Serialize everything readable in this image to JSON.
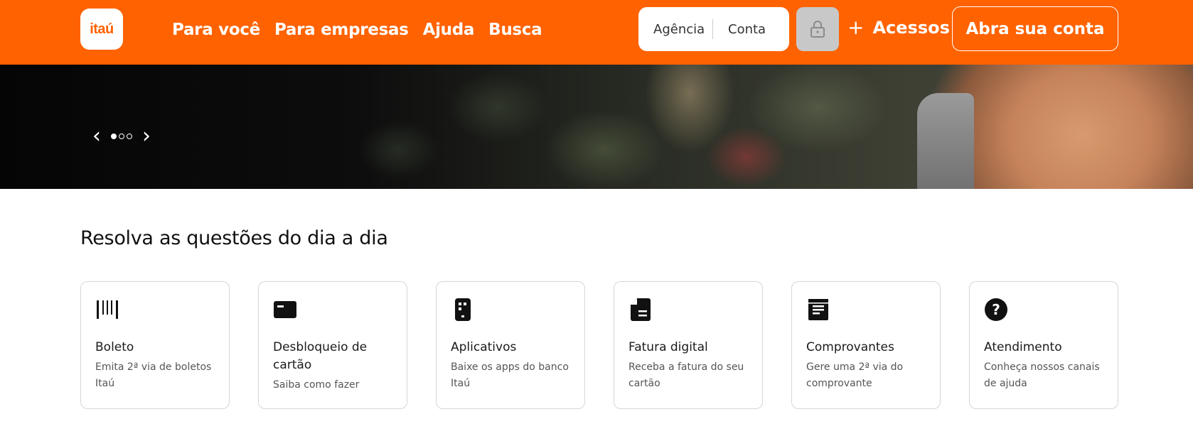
{
  "header": {
    "logo_text": "itaú",
    "nav": [
      "Para você",
      "Para empresas",
      "Ajuda",
      "Busca"
    ],
    "login": {
      "agencia_placeholder": "Agência",
      "conta_placeholder": "Conta"
    },
    "acessos_label": "Acessos",
    "abra_conta_label": "Abra sua conta",
    "brand_color": "#ff6200"
  },
  "hero": {
    "slide_count": 3,
    "active_slide": 1
  },
  "section": {
    "title": "Resolva as questões do dia a dia",
    "cards": [
      {
        "icon": "barcode-icon",
        "title": "Boleto",
        "desc": "Emita 2ª via de boletos Itaú"
      },
      {
        "icon": "card-icon",
        "title": "Desbloqueio de cartão",
        "desc": "Saiba como fazer"
      },
      {
        "icon": "phone-icon",
        "title": "Aplicativos",
        "desc": "Baixe os apps do banco Itaú"
      },
      {
        "icon": "document-icon",
        "title": "Fatura digital",
        "desc": "Receba a fatura do seu cartão"
      },
      {
        "icon": "receipt-icon",
        "title": "Comprovantes",
        "desc": "Gere uma 2ª via do comprovante"
      },
      {
        "icon": "help-icon",
        "title": "Atendimento",
        "desc": "Conheça nossos canais de ajuda"
      }
    ]
  }
}
